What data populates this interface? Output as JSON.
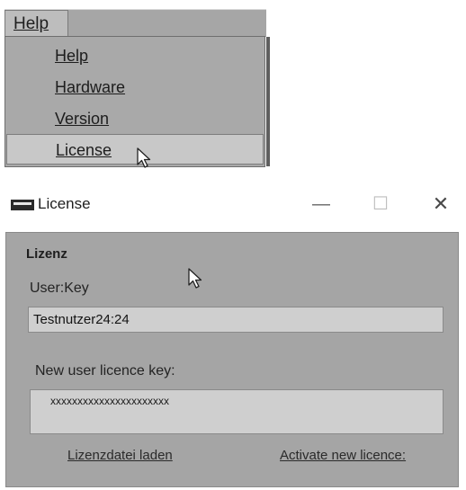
{
  "menu": {
    "menubar_help": "Help",
    "items": [
      {
        "label": "Help"
      },
      {
        "label": "Hardware"
      },
      {
        "label": "Version"
      },
      {
        "label": "License"
      }
    ]
  },
  "window": {
    "title": "License",
    "minimize_glyph": "—",
    "maximize_glyph": "☐",
    "close_glyph": "✕"
  },
  "dialog": {
    "group_title": "Lizenz",
    "user_key_label": "User:Key",
    "user_key_value": "Testnutzer24:24",
    "new_key_label": "New user licence key:",
    "new_key_value": "xxxxxxxxxxxxxxxxxxxxxx",
    "load_link": "Lizenzdatei laden",
    "activate_link": "Activate new licence:"
  },
  "icons": {
    "window_icon": "window-app-icon",
    "cursor": "mouse-pointer-icon"
  },
  "colors": {
    "dialog_bg": "#a5a5a5",
    "textbox_bg": "#cfcfcf",
    "menu_bg": "#a9a9a9",
    "selected_bg": "#c8c8c8"
  }
}
